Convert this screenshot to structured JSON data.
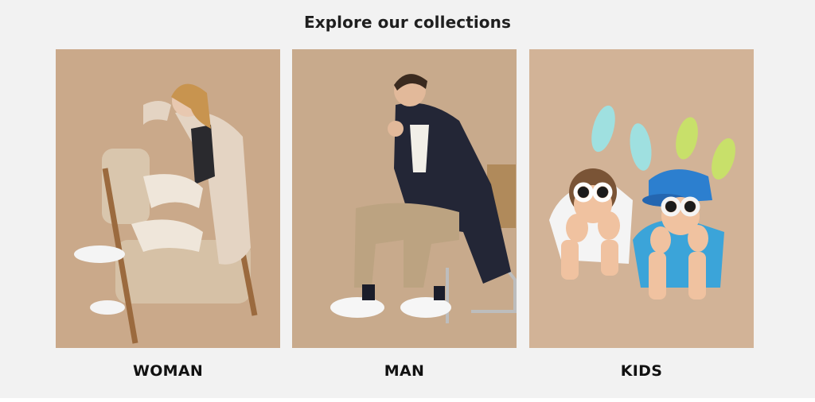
{
  "page": {
    "heading": "Explore our collections"
  },
  "collections": [
    {
      "id": "woman",
      "label": "WOMAN",
      "image": "woman-seated-in-armchair-photo"
    },
    {
      "id": "man",
      "label": "MAN",
      "image": "man-seated-on-chair-photo"
    },
    {
      "id": "kids",
      "label": "KIDS",
      "image": "kids-lying-with-sunglasses-photo"
    }
  ],
  "colors": {
    "section_background": "#f2f2f2",
    "photo_backdrop": "#c9a98a",
    "text": "#111111"
  }
}
